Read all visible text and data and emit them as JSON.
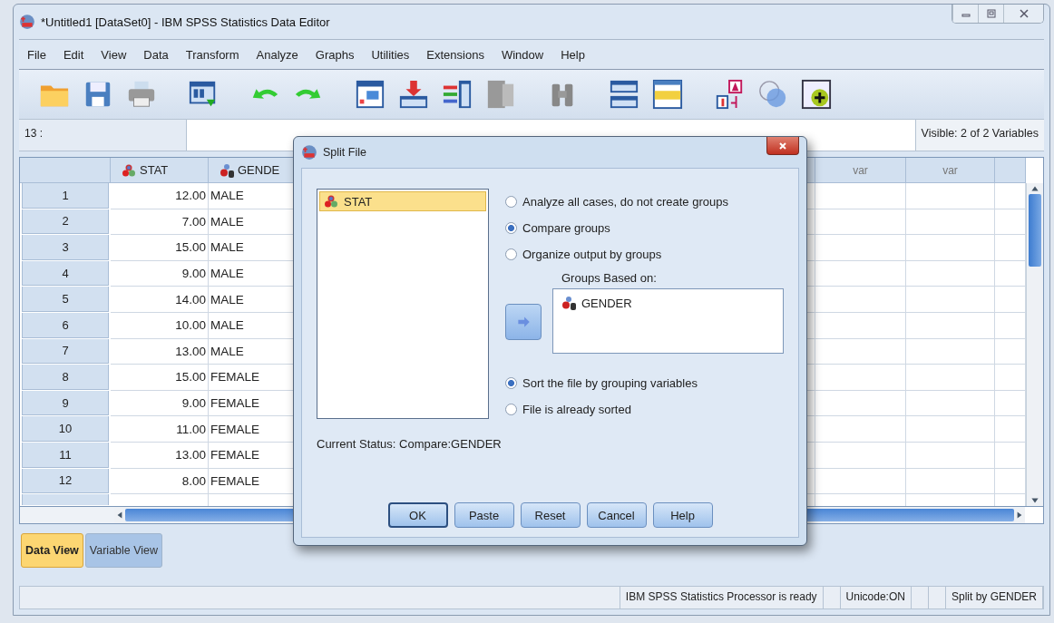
{
  "window": {
    "title": "*Untitled1 [DataSet0] - IBM SPSS Statistics Data Editor"
  },
  "menu": [
    "File",
    "Edit",
    "View",
    "Data",
    "Transform",
    "Analyze",
    "Graphs",
    "Utilities",
    "Extensions",
    "Window",
    "Help"
  ],
  "cell_editor": {
    "cell": "13 :",
    "visible": "Visible: 2 of 2 Variables"
  },
  "grid": {
    "columns": [
      {
        "kind": "scale",
        "label": "STAT"
      },
      {
        "kind": "nominal",
        "label": "GENDE"
      },
      {
        "kind": "empty",
        "label": "var"
      },
      {
        "kind": "empty",
        "label": "var"
      }
    ],
    "rows": [
      {
        "number": "1",
        "stat": "12.00",
        "gender": "MALE"
      },
      {
        "number": "2",
        "stat": "7.00",
        "gender": "MALE"
      },
      {
        "number": "3",
        "stat": "15.00",
        "gender": "MALE"
      },
      {
        "number": "4",
        "stat": "9.00",
        "gender": "MALE"
      },
      {
        "number": "5",
        "stat": "14.00",
        "gender": "MALE"
      },
      {
        "number": "6",
        "stat": "10.00",
        "gender": "MALE"
      },
      {
        "number": "7",
        "stat": "13.00",
        "gender": "MALE"
      },
      {
        "number": "8",
        "stat": "15.00",
        "gender": "FEMALE"
      },
      {
        "number": "9",
        "stat": "9.00",
        "gender": "FEMALE"
      },
      {
        "number": "10",
        "stat": "11.00",
        "gender": "FEMALE"
      },
      {
        "number": "11",
        "stat": "13.00",
        "gender": "FEMALE"
      },
      {
        "number": "12",
        "stat": "8.00",
        "gender": "FEMALE"
      }
    ]
  },
  "view_tabs": [
    {
      "label": "Data View",
      "selected": true
    },
    {
      "label": "Variable View",
      "selected": false
    }
  ],
  "status_bar": {
    "processor": "IBM SPSS Statistics Processor is ready",
    "unicode": "Unicode:ON",
    "split": "Split by GENDER"
  },
  "dialog": {
    "title": "Split File",
    "variables": [
      {
        "name": "STAT",
        "kind": "scale",
        "selected": true
      }
    ],
    "options": [
      {
        "label": "Analyze all cases, do not create groups",
        "selected": false
      },
      {
        "label": "Compare groups",
        "selected": true
      },
      {
        "label": "Organize output by groups",
        "selected": false
      }
    ],
    "groups_label": "Groups Based on:",
    "groups": [
      {
        "name": "GENDER",
        "kind": "nominal"
      }
    ],
    "sort_options": [
      {
        "label": "Sort the file by grouping variables",
        "selected": true
      },
      {
        "label": "File is already sorted",
        "selected": false
      }
    ],
    "status": "Current Status: Compare:GENDER",
    "buttons": [
      "OK",
      "Paste",
      "Reset",
      "Cancel",
      "Help"
    ]
  }
}
